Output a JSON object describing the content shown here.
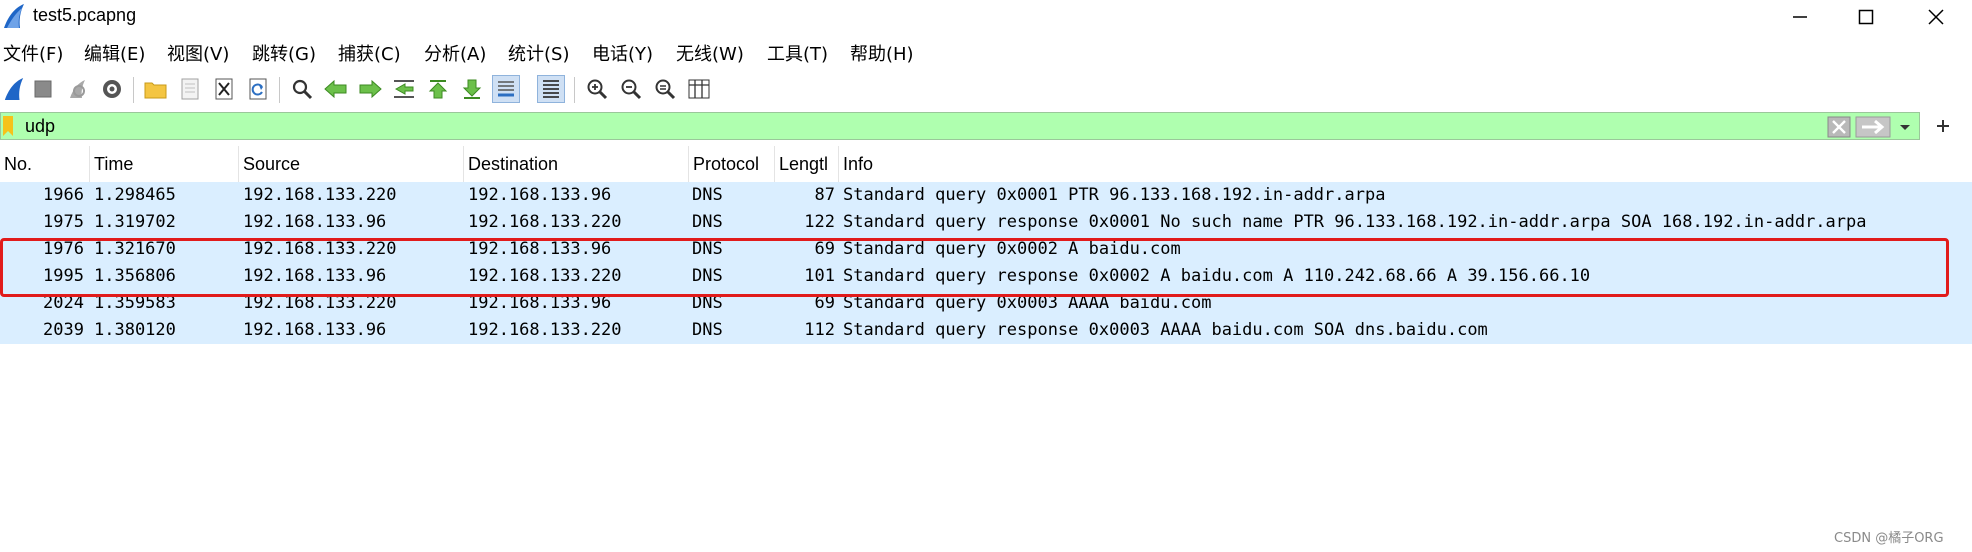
{
  "window": {
    "title": "test5.pcapng"
  },
  "menu": [
    "文件(F)",
    "编辑(E)",
    "视图(V)",
    "跳转(G)",
    "捕获(C)",
    "分析(A)",
    "统计(S)",
    "电话(Y)",
    "无线(W)",
    "工具(T)",
    "帮助(H)"
  ],
  "toolbar": [
    {
      "name": "start-capture-icon"
    },
    {
      "name": "stop-capture-icon"
    },
    {
      "name": "restart-capture-icon"
    },
    {
      "name": "capture-options-icon"
    },
    {
      "name": "open-file-icon"
    },
    {
      "name": "save-file-icon"
    },
    {
      "name": "close-file-icon"
    },
    {
      "name": "reload-file-icon"
    },
    {
      "name": "find-packet-icon"
    },
    {
      "name": "go-back-icon"
    },
    {
      "name": "go-forward-icon"
    },
    {
      "name": "go-to-packet-icon"
    },
    {
      "name": "go-first-icon"
    },
    {
      "name": "go-last-icon"
    },
    {
      "name": "auto-scroll-icon"
    },
    {
      "name": "colorize-icon"
    },
    {
      "name": "zoom-in-icon"
    },
    {
      "name": "zoom-out-icon"
    },
    {
      "name": "zoom-normal-icon"
    },
    {
      "name": "resize-columns-icon"
    }
  ],
  "filter": {
    "value": "udp"
  },
  "columns": [
    "No.",
    "Time",
    "Source",
    "Destination",
    "Protocol",
    "Lengtl",
    "Info"
  ],
  "packets": [
    {
      "no": "1966",
      "time": "1.298465",
      "src": "192.168.133.220",
      "dst": "192.168.133.96",
      "proto": "DNS",
      "len": "87",
      "info": "Standard query 0x0001 PTR 96.133.168.192.in-addr.arpa"
    },
    {
      "no": "1975",
      "time": "1.319702",
      "src": "192.168.133.96",
      "dst": "192.168.133.220",
      "proto": "DNS",
      "len": "122",
      "info": "Standard query response 0x0001 No such name PTR 96.133.168.192.in-addr.arpa SOA 168.192.in-addr.arpa"
    },
    {
      "no": "1976",
      "time": "1.321670",
      "src": "192.168.133.220",
      "dst": "192.168.133.96",
      "proto": "DNS",
      "len": "69",
      "info": "Standard query 0x0002 A baidu.com"
    },
    {
      "no": "1995",
      "time": "1.356806",
      "src": "192.168.133.96",
      "dst": "192.168.133.220",
      "proto": "DNS",
      "len": "101",
      "info": "Standard query response 0x0002 A baidu.com A 110.242.68.66 A 39.156.66.10"
    },
    {
      "no": "2024",
      "time": "1.359583",
      "src": "192.168.133.220",
      "dst": "192.168.133.96",
      "proto": "DNS",
      "len": "69",
      "info": "Standard query 0x0003 AAAA baidu.com"
    },
    {
      "no": "2039",
      "time": "1.380120",
      "src": "192.168.133.96",
      "dst": "192.168.133.220",
      "proto": "DNS",
      "len": "112",
      "info": "Standard query response 0x0003 AAAA baidu.com SOA dns.baidu.com"
    }
  ],
  "colors": {
    "row_bg": "#daeeff",
    "filter_bg": "#afffaf",
    "highlight": "#e11b1b"
  },
  "watermark": "CSDN @橘子ORG"
}
